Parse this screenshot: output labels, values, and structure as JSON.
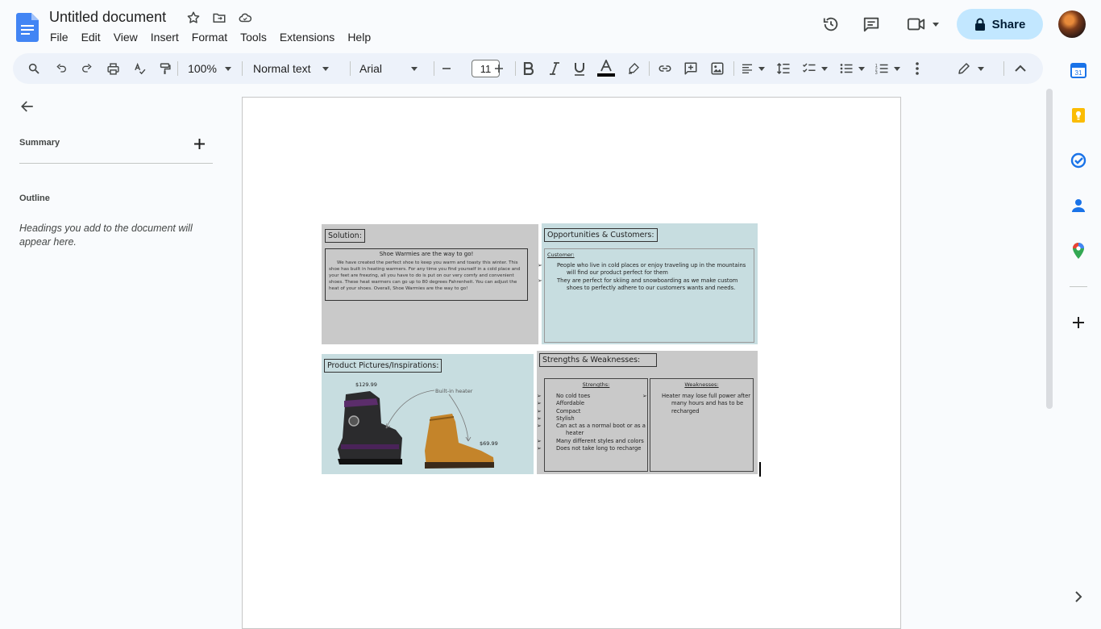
{
  "app": {
    "title": "Untitled document"
  },
  "menus": [
    "File",
    "Edit",
    "View",
    "Insert",
    "Format",
    "Tools",
    "Extensions",
    "Help"
  ],
  "share": {
    "label": "Share"
  },
  "toolbar": {
    "zoom": "100%",
    "style": "Normal text",
    "font": "Arial",
    "font_size": "11"
  },
  "sidebar": {
    "summary_label": "Summary",
    "outline_label": "Outline",
    "outline_hint": "Headings you add to the document will appear here."
  },
  "slide": {
    "solution": {
      "label": "Solution:",
      "heading": "Shoe Warmies are the way to go!",
      "body": "We have created the perfect shoe to keep you warm and toasty this winter. This shoe has built in heating warmers. For any time you find yourself in a cold place and your feet are freezing, all you have to do is put on our very comfy and convenient shoes. These heat warmers can go up to 80 degrees Fahrenheit. You can adjust the heat of your shoes. Overall, Shoe Warmies are the way to go!"
    },
    "opportunities": {
      "label": "Opportunities & Customers:",
      "sub": "Customer:",
      "items": [
        "People who live in cold places or enjoy traveling up in the mountains will find our product perfect for them",
        "They are perfect for skiing and snowboarding as we make custom shoes to perfectly adhere to our customers wants and needs."
      ]
    },
    "pictures": {
      "label": "Product Pictures/Inspirations:",
      "price1": "$129.99",
      "heater": "Built-in heater",
      "price2": "$69.99"
    },
    "strengths": {
      "label": "Strengths & Weaknesses:",
      "strengths_title": "Strengths:",
      "strengths": [
        "No cold toes",
        "Affordable",
        "Compact",
        "Stylish",
        "Can act as a normal boot or as a heater",
        "Many different styles and colors",
        "Does not take long to recharge"
      ],
      "weaknesses_title": "Weaknesses:",
      "weaknesses": [
        "Heater may lose full power after many hours and has to be recharged"
      ]
    }
  },
  "colors": {
    "accent": "#0b57d0",
    "share_bg": "#c2e7ff",
    "toolbar_bg": "#edf2fa",
    "panel_grey": "#c9c9c9",
    "panel_blue": "#c7dde0"
  }
}
